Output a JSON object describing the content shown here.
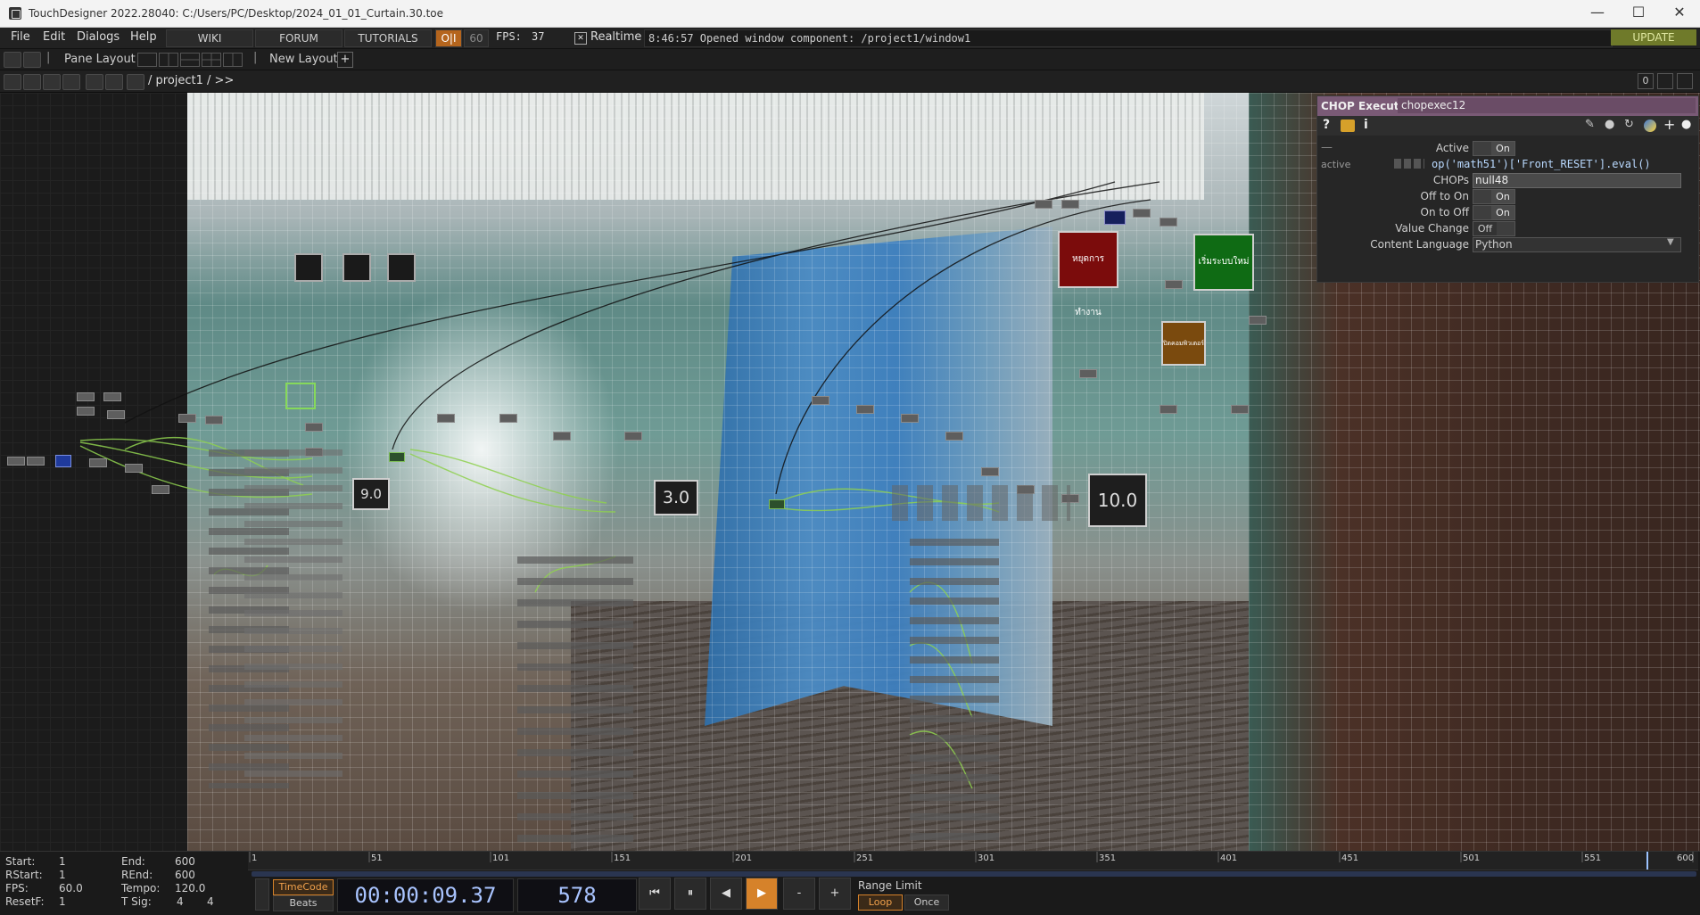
{
  "window": {
    "title": "TouchDesigner 2022.28040: C:/Users/PC/Desktop/2024_01_01_Curtain.30.toe",
    "minimize": "—",
    "maximize": "☐",
    "close": "✕"
  },
  "menubar": {
    "items": [
      "File",
      "Edit",
      "Dialogs",
      "Help"
    ],
    "wiki": "WIKI",
    "forum": "FORUM",
    "tutorials": "TUTORIALS",
    "perf_badge": "O|I",
    "fps_cap": "60",
    "fps_label": "FPS:",
    "fps_value": "37",
    "realtime_label": "Realtime",
    "realtime_checked": "✕",
    "status_message": "8:46:57 Opened window component: /project1/window1",
    "update_button": "UPDATE",
    "colors": {
      "update_bg": "#6f7a2a",
      "perf_badge_bg": "#b5651d"
    }
  },
  "panebar": {
    "pane_layout_label": "Pane Layout",
    "new_layout_label": "New Layout",
    "add_symbol": "+"
  },
  "pathbar": {
    "path": "/ project1 / >>",
    "pane_index": "0"
  },
  "network": {
    "value_displays": [
      "9.0",
      "3.0",
      "10.0"
    ],
    "buttons": [
      {
        "label": "หยุดการทำงาน",
        "color": "#7b0c0c"
      },
      {
        "label": "เริ่มระบบใหม่",
        "color": "#0f6b14"
      },
      {
        "label": "ปิดคอมพิวเตอร์",
        "color": "#7a4a0e"
      }
    ]
  },
  "params": {
    "op_type": "CHOP Execute",
    "op_name": "chopexec12",
    "help_icon": "?",
    "info_icon": "i",
    "rows": [
      {
        "label": "Active",
        "value": "On"
      },
      {
        "label": "CHOPs",
        "value": "null48"
      },
      {
        "label": "Off to On",
        "value": "On"
      },
      {
        "label": "On to Off",
        "value": "On"
      },
      {
        "label": "Value Change",
        "value": "Off"
      },
      {
        "label": "Content Language",
        "value": "Python"
      }
    ],
    "active_expr_label": "active",
    "active_expression": "op('math51')['Front_RESET'].eval()",
    "header_color": "#7a5a76"
  },
  "timeline": {
    "start_label": "Start:",
    "start": "1",
    "rstart_label": "RStart:",
    "rstart": "1",
    "fps_label": "FPS:",
    "fps": "60.0",
    "resetf_label": "ResetF:",
    "resetf": "1",
    "end_label": "End:",
    "end": "600",
    "rend_label": "REnd:",
    "rend": "600",
    "tempo_label": "Tempo:",
    "tempo": "120.0",
    "tsig_label": "T Sig:",
    "tsig_num": "4",
    "tsig_den": "4",
    "ruler_ticks": [
      "1",
      "51",
      "101",
      "151",
      "201",
      "251",
      "301",
      "351",
      "401",
      "451",
      "501",
      "551",
      "600"
    ],
    "timecode_label": "TimeCode",
    "beats_label": "Beats",
    "timecode": "00:00:09.37",
    "frame": "578",
    "range_limit_label": "Range Limit",
    "loop_label": "Loop",
    "once_label": "Once",
    "transport": [
      "⏮",
      "⏸",
      "◀",
      "▶",
      "-",
      "+"
    ],
    "colors": {
      "accent": "#d6822a"
    }
  }
}
